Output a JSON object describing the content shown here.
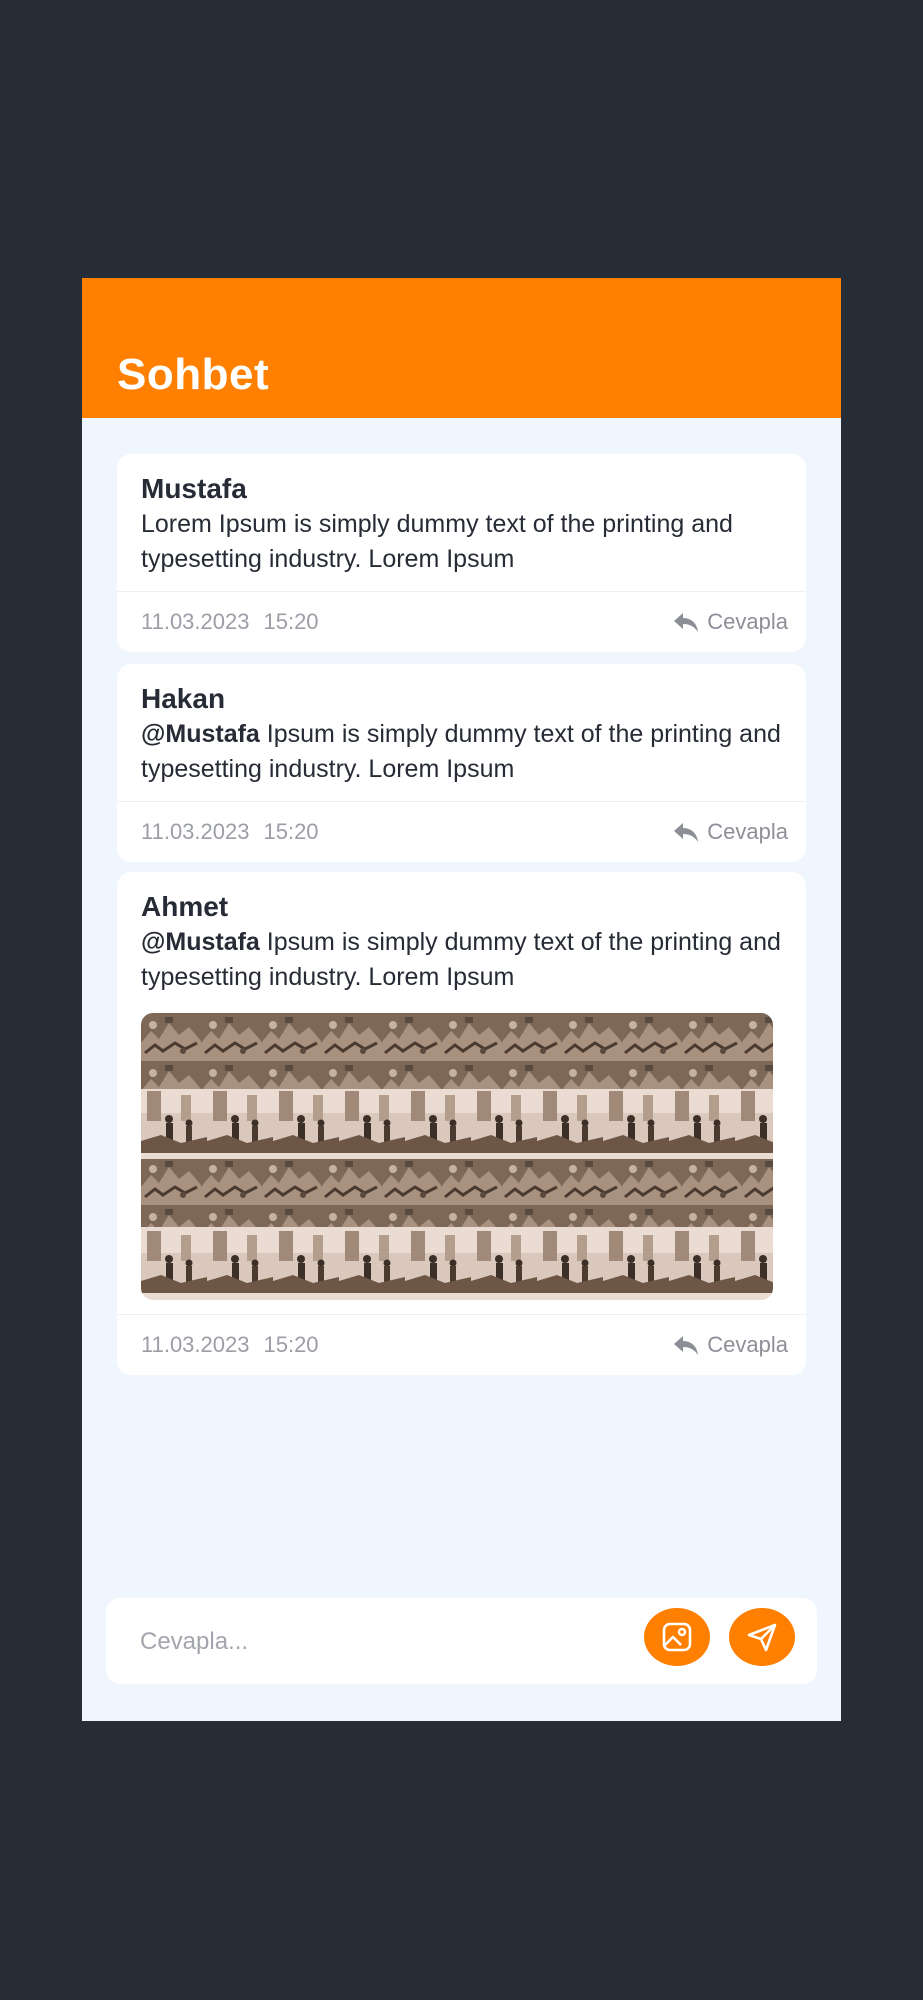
{
  "header": {
    "title": "Sohbet"
  },
  "messages": [
    {
      "author": "Mustafa",
      "mention": "",
      "text": "Lorem Ipsum is simply dummy text of the printing and typesetting industry. Lorem Ipsum",
      "date": "11.03.2023",
      "time": "15:20",
      "reply_label": "Cevapla"
    },
    {
      "author": "Hakan",
      "mention": "@Mustafa",
      "text": "Ipsum is simply dummy text of the printing and typesetting industry. Lorem Ipsum",
      "date": "11.03.2023",
      "time": "15:20",
      "reply_label": "Cevapla"
    },
    {
      "author": "Ahmet",
      "mention": "@Mustafa",
      "text": "Ipsum is simply dummy text of the printing and typesetting industry. Lorem Ipsum",
      "date": "11.03.2023",
      "time": "15:20",
      "reply_label": "Cevapla",
      "has_photo": true
    }
  ],
  "composer": {
    "placeholder": "Cevapla..."
  },
  "icons": {
    "reply": "reply-arrow-icon",
    "attach_image": "image-icon",
    "send": "paper-plane-icon"
  },
  "colors": {
    "accent": "#ff7f00",
    "background": "#272d36",
    "panel": "#eff6fe",
    "text": "#262b35",
    "muted": "#9c9ea6"
  }
}
